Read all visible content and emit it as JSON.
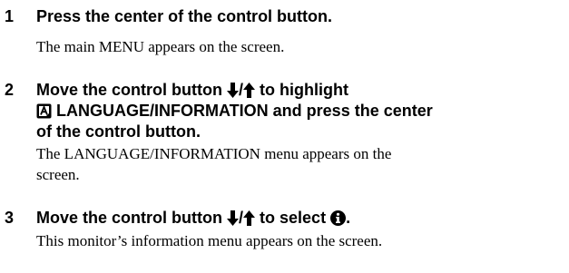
{
  "steps": [
    {
      "number": "1",
      "heading": "Press the center of the control button.",
      "body": "The main MENU appears on the screen."
    },
    {
      "number": "2",
      "heading_line1_a": "Move the control button",
      "heading_line1_sep": "/",
      "heading_line1_b": "to highlight",
      "heading_line2": "LANGUAGE/INFORMATION and press the center",
      "heading_line3": "of the control button.",
      "body_line1": "The LANGUAGE/INFORMATION menu appears on the",
      "body_line2": "screen."
    },
    {
      "number": "3",
      "heading_a": "Move the control button",
      "heading_sep": "/",
      "heading_b": "to select",
      "heading_end": ".",
      "body": "This monitor’s information menu appears on the screen."
    }
  ],
  "icons": {
    "down_arrow": "down-arrow-icon",
    "up_arrow": "up-arrow-icon",
    "language_menu": "language-information-menu-icon",
    "information": "information-icon"
  },
  "colors": {
    "text": "#000000",
    "background": "#ffffff"
  }
}
